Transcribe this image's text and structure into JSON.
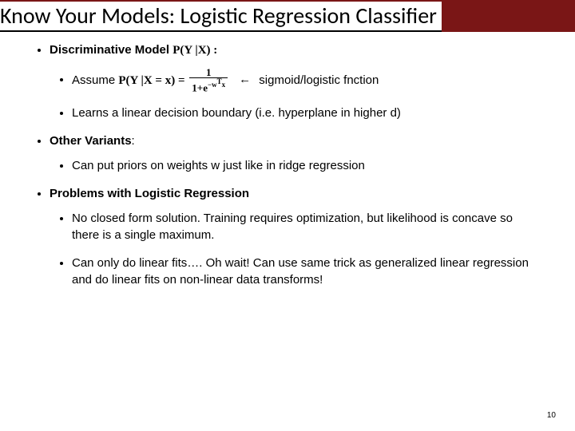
{
  "title": "Know Your Models: Logistic Regression Classifier",
  "sections": [
    {
      "heading_prefix": "Discriminative Model ",
      "heading_math": "P(Y |X) :",
      "subs": [
        {
          "prefix": "Assume ",
          "math_lhs": "P(Y |X = x) = ",
          "frac_num": "1",
          "frac_den": "1+e^{−w^{T}x}",
          "arrow": "←",
          "after": " sigmoid/logistic fnction"
        },
        {
          "text": "Learns a linear decision boundary (i.e. hyperplane in higher d)"
        }
      ]
    },
    {
      "heading_prefix": "Other Variants",
      "heading_suffix": ":",
      "subs": [
        {
          "text": "Can put priors on weights w just like in ridge regression"
        }
      ]
    },
    {
      "heading_prefix": "Problems with Logistic Regression",
      "heading_suffix": "",
      "subs": [
        {
          "text": "No closed form solution. Training requires optimization, but likelihood is concave so there is a single maximum."
        },
        {
          "text": "Can only do linear fits…. Oh wait! Can use same trick as generalized linear regression and do linear fits on non-linear data transforms!"
        }
      ]
    }
  ],
  "slide_number": "10"
}
